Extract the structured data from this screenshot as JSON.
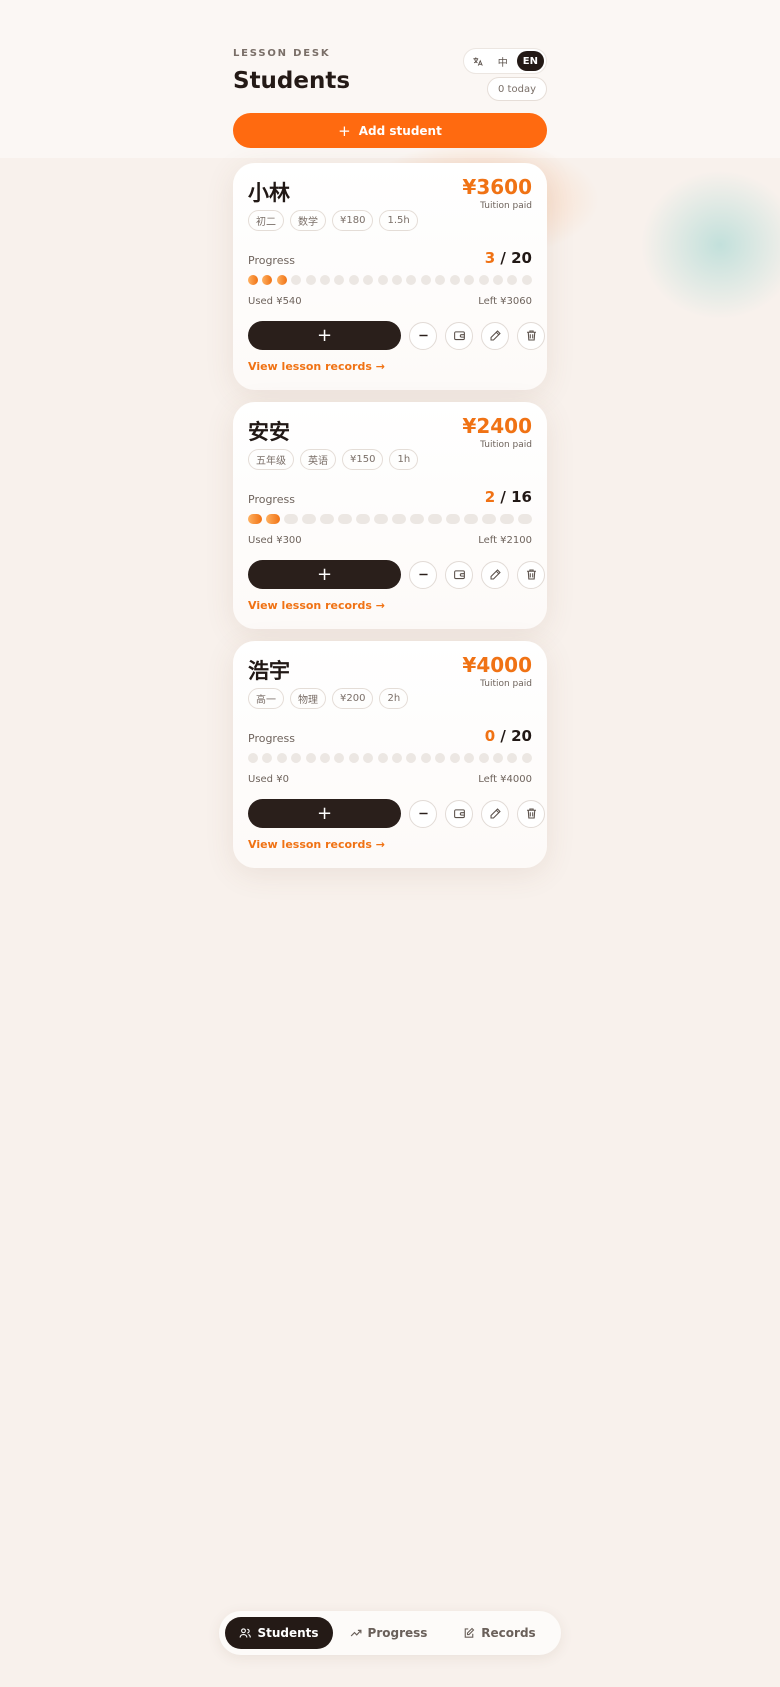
{
  "header": {
    "eyebrow": "LESSON DESK",
    "title": "Students",
    "lang_options": [
      {
        "label": "文A",
        "icon": "translate-icon",
        "active": false
      },
      {
        "label": "中",
        "active": false
      },
      {
        "label": "EN",
        "active": true
      }
    ],
    "today": "0 today"
  },
  "add_button": {
    "label": "Add student",
    "icon": "plus-icon"
  },
  "colors": {
    "accent": "#f07214",
    "button": "#ff6a10",
    "dark": "#241a16"
  },
  "students": [
    {
      "name": "小林",
      "tags": [
        "初二",
        "数学",
        "¥180",
        "1.5h"
      ],
      "paid": "¥3600",
      "paid_label": "Tuition paid",
      "progress_label": "Progress",
      "done": "3",
      "total": "20",
      "done_num": 3,
      "total_num": 20,
      "used": "Used ¥540",
      "left": "Left ¥3060",
      "add_symbol": "+",
      "records_link": "View lesson records →"
    },
    {
      "name": "安安",
      "tags": [
        "五年级",
        "英语",
        "¥150",
        "1h"
      ],
      "paid": "¥2400",
      "paid_label": "Tuition paid",
      "progress_label": "Progress",
      "done": "2",
      "total": "16",
      "done_num": 2,
      "total_num": 16,
      "used": "Used ¥300",
      "left": "Left ¥2100",
      "add_symbol": "+",
      "records_link": "View lesson records →"
    },
    {
      "name": "浩宇",
      "tags": [
        "高一",
        "物理",
        "¥200",
        "2h"
      ],
      "paid": "¥4000",
      "paid_label": "Tuition paid",
      "progress_label": "Progress",
      "done": "0",
      "total": "20",
      "done_num": 0,
      "total_num": 20,
      "used": "Used ¥0",
      "left": "Left ¥4000",
      "add_symbol": "+",
      "records_link": "View lesson records →"
    }
  ],
  "card_action_icons": [
    "minus-icon",
    "wallet-icon",
    "pencil-icon",
    "trash-icon"
  ],
  "nav": [
    {
      "label": "Students",
      "icon": "users-icon",
      "active": true
    },
    {
      "label": "Progress",
      "icon": "trend-icon",
      "active": false
    },
    {
      "label": "Records",
      "icon": "edit-note-icon",
      "active": false
    }
  ]
}
